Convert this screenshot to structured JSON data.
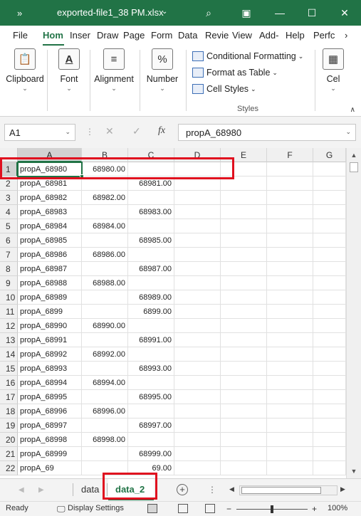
{
  "titlebar": {
    "quick_access": "»",
    "title": "exported-file1_38 PM.xlsx",
    "title_caret": "⌄",
    "search_icon": "⌕",
    "ribbon_display_icon": "▣",
    "minimize": "—",
    "maximize": "☐",
    "close": "✕"
  },
  "ribbon_tabs": [
    "File",
    "Hom",
    "Inser",
    "Draw",
    "Page",
    "Form",
    "Data",
    "Revie",
    "View",
    "Add-",
    "Help",
    "Perfc"
  ],
  "ribbon_tabs_overflow": "›",
  "ribbon": {
    "clipboard": {
      "label": "Clipboard",
      "icon": "📋"
    },
    "font": {
      "label": "Font",
      "icon": "A"
    },
    "alignment": {
      "label": "Alignment",
      "icon": "≡"
    },
    "number": {
      "label": "Number",
      "icon": "%"
    },
    "styles": {
      "conditional_formatting": "Conditional Formatting",
      "format_as_table": "Format as Table",
      "cell_styles": "Cell Styles",
      "caption": "Styles"
    },
    "cells": {
      "label": "Cel"
    },
    "chevron": "⌄",
    "collapse_icon": "∧"
  },
  "formula_bar": {
    "name_box": "A1",
    "cancel": "✕",
    "enter": "✓",
    "fx": "fx",
    "value": "propA_68980",
    "dropdown": "⌄"
  },
  "columns": [
    "A",
    "B",
    "C",
    "D",
    "E",
    "F",
    "G"
  ],
  "rows": [
    {
      "n": "1",
      "a": "propA_68980",
      "b": "68980.00",
      "c": ""
    },
    {
      "n": "2",
      "a": "propA_68981",
      "b": "",
      "c": "68981.00"
    },
    {
      "n": "3",
      "a": "propA_68982",
      "b": "68982.00",
      "c": ""
    },
    {
      "n": "4",
      "a": "propA_68983",
      "b": "",
      "c": "68983.00"
    },
    {
      "n": "5",
      "a": "propA_68984",
      "b": "68984.00",
      "c": ""
    },
    {
      "n": "6",
      "a": "propA_68985",
      "b": "",
      "c": "68985.00"
    },
    {
      "n": "7",
      "a": "propA_68986",
      "b": "68986.00",
      "c": ""
    },
    {
      "n": "8",
      "a": "propA_68987",
      "b": "",
      "c": "68987.00"
    },
    {
      "n": "9",
      "a": "propA_68988",
      "b": "68988.00",
      "c": ""
    },
    {
      "n": "10",
      "a": "propA_68989",
      "b": "",
      "c": "68989.00"
    },
    {
      "n": "11",
      "a": "propA_6899",
      "b": "",
      "c": "6899.00"
    },
    {
      "n": "12",
      "a": "propA_68990",
      "b": "68990.00",
      "c": ""
    },
    {
      "n": "13",
      "a": "propA_68991",
      "b": "",
      "c": "68991.00"
    },
    {
      "n": "14",
      "a": "propA_68992",
      "b": "68992.00",
      "c": ""
    },
    {
      "n": "15",
      "a": "propA_68993",
      "b": "",
      "c": "68993.00"
    },
    {
      "n": "16",
      "a": "propA_68994",
      "b": "68994.00",
      "c": ""
    },
    {
      "n": "17",
      "a": "propA_68995",
      "b": "",
      "c": "68995.00"
    },
    {
      "n": "18",
      "a": "propA_68996",
      "b": "68996.00",
      "c": ""
    },
    {
      "n": "19",
      "a": "propA_68997",
      "b": "",
      "c": "68997.00"
    },
    {
      "n": "20",
      "a": "propA_68998",
      "b": "68998.00",
      "c": ""
    },
    {
      "n": "21",
      "a": "propA_68999",
      "b": "",
      "c": "68999.00"
    },
    {
      "n": "22",
      "a": "propA_69",
      "b": "",
      "c": "69.00"
    }
  ],
  "sheet_tabs": {
    "nav_prev": "◀",
    "nav_next": "▶",
    "tabs": [
      "data",
      "data_2"
    ],
    "active": "data_2",
    "add": "+",
    "more": "⋮"
  },
  "statusbar": {
    "ready": "Ready",
    "display_settings": "Display Settings",
    "zoom_minus": "−",
    "zoom_plus": "+",
    "zoom": "100%"
  },
  "colors": {
    "accent": "#217346",
    "highlight": "#e0101f"
  }
}
